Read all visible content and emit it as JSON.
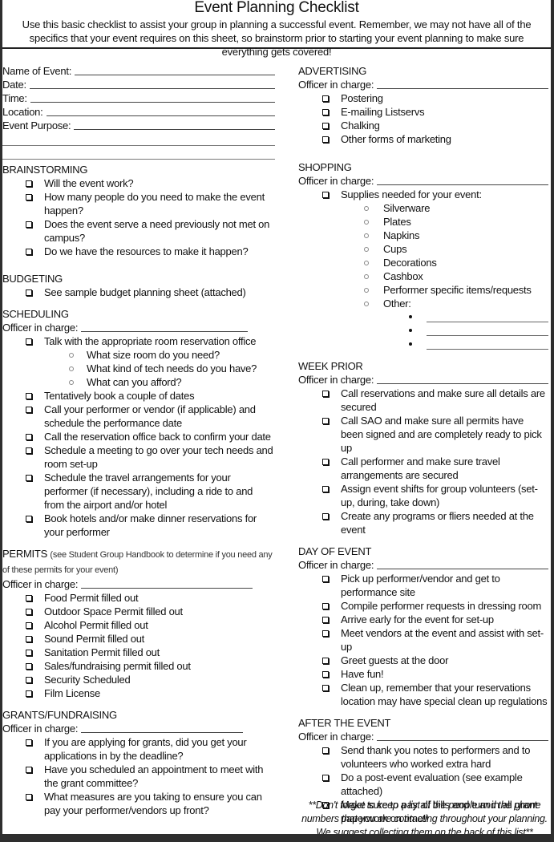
{
  "header": {
    "title": "Event Planning Checklist",
    "intro": "Use this basic checklist to assist your group in planning a successful event.  Remember, we may not have all of the specifics that your event requires on this sheet, so brainstorm prior to starting your event planning to make sure everything gets covered!"
  },
  "event_fields": {
    "name": "Name of Event:",
    "date": "Date:",
    "time": "Time:",
    "location": "Location:",
    "purpose": "Event Purpose:"
  },
  "officer_label": "Officer in charge:",
  "brainstorming": {
    "title": "BRAINSTORMING",
    "items": [
      "Will the event work?",
      "How many people do you need to make the event happen?",
      "Does the event serve a need previously not met on campus?",
      "Do we have the resources to make it happen?"
    ]
  },
  "budgeting": {
    "title": "BUDGETING",
    "items": [
      "See sample budget planning sheet (attached)"
    ]
  },
  "scheduling": {
    "title": "SCHEDULING",
    "item0": "Talk with the appropriate room reservation office",
    "subitems": [
      "What size room do you need?",
      "What kind of tech needs do you have?",
      "What can you afford?"
    ],
    "items": [
      "Tentatively book a couple of dates",
      "Call your performer or vendor (if applicable) and schedule the performance date",
      "Call the reservation office back to confirm your date",
      "Schedule a meeting to go over your tech needs and room set-up",
      "Schedule the travel arrangements for your performer (if necessary), including a ride to and from the airport and/or hotel",
      "Book hotels and/or make dinner reservations for your performer"
    ]
  },
  "permits": {
    "title": "PERMITS",
    "note": "(see Student Group Handbook to determine if you need any of these permits for your event)",
    "items": [
      "Food Permit filled out",
      "Outdoor Space Permit filled out",
      "Alcohol Permit filled out",
      "Sound Permit filled out",
      "Sanitation Permit filled out",
      "Sales/fundraising permit filled out",
      "Security Scheduled",
      "Film License"
    ]
  },
  "grants": {
    "title": "GRANTS/FUNDRAISING",
    "items": [
      "If you are applying for grants, did you get your applications in by the deadline?",
      "Have you scheduled an appointment to meet with the grant committee?",
      "What measures are you taking to ensure you can pay your performer/vendors up front?"
    ]
  },
  "advertising": {
    "title": "ADVERTISING",
    "items": [
      "Postering",
      "E-mailing Listservs",
      "Chalking",
      "Other forms of marketing"
    ]
  },
  "shopping": {
    "title": "SHOPPING",
    "item0": "Supplies needed for your event:",
    "subitems": [
      "Silverware",
      "Plates",
      "Napkins",
      "Cups",
      "Decorations",
      "Cashbox",
      "Performer specific items/requests",
      "Other:"
    ]
  },
  "week_prior": {
    "title": "WEEK PRIOR",
    "items": [
      "Call reservations and make sure all details are secured",
      "Call SAO and make sure all permits have been signed and are completely ready to pick up",
      "Call performer and make sure travel arrangements are secured",
      "Assign event shifts for group volunteers (set-up, during, take down)",
      "Create any programs or fliers needed at the event"
    ]
  },
  "day_of": {
    "title": "DAY OF EVENT",
    "items": [
      "Pick up performer/vendor and get to performance site",
      "Compile performer requests in dressing room",
      "Arrive early for the event for set-up",
      "Meet vendors at the event and assist with set-up",
      "Greet guests at the door",
      "Have fun!",
      "Clean up, remember that your reservations location may have special clean up regulations"
    ]
  },
  "after": {
    "title": "AFTER THE EVENT",
    "items": [
      "Send thank you notes to performers and to volunteers who worked extra hard",
      "Do a post-event evaluation (see example attached)",
      "Make sure to pay all bills and turn in all grant paperwork on time!!"
    ]
  },
  "footer_note": "**Don't forget to keep a list of the people and the phone numbers that you are contacting throughout your planning. We suggest collecting them on the back of this list**"
}
